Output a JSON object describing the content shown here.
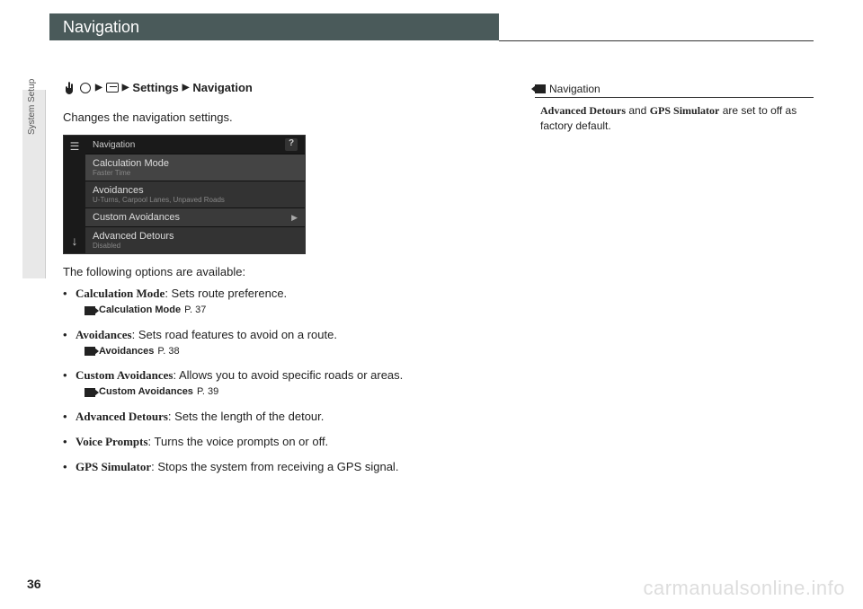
{
  "header": {
    "title": "Navigation"
  },
  "sidebar": {
    "section_label": "System Setup"
  },
  "breadcrumb": {
    "step3": "Settings",
    "step4": "Navigation"
  },
  "intro": "Changes the navigation settings.",
  "screenshot": {
    "title": "Navigation",
    "rows": [
      {
        "title": "Calculation Mode",
        "sub": "Faster Time"
      },
      {
        "title": "Avoidances",
        "sub": "U-Turns, Carpool Lanes, Unpaved Roads"
      },
      {
        "title": "Custom Avoidances",
        "sub": ""
      },
      {
        "title": "Advanced Detours",
        "sub": "Disabled"
      }
    ]
  },
  "options_intro": "The following options are available:",
  "options": [
    {
      "name": "Calculation Mode",
      "desc": ": Sets route preference.",
      "ref_label": "Calculation Mode",
      "ref_page": "P. 37"
    },
    {
      "name": "Avoidances",
      "desc": ": Sets road features to avoid on a route.",
      "ref_label": "Avoidances",
      "ref_page": "P. 38"
    },
    {
      "name": "Custom Avoidances",
      "desc": ": Allows you to avoid specific roads or areas.",
      "ref_label": "Custom Avoidances",
      "ref_page": "P. 39"
    },
    {
      "name": "Advanced Detours",
      "desc": ": Sets the length of the detour."
    },
    {
      "name": "Voice Prompts",
      "desc": ": Turns the voice prompts on or off."
    },
    {
      "name": "GPS Simulator",
      "desc": ": Stops the system from receiving a GPS signal."
    }
  ],
  "sidenote": {
    "title": "Navigation",
    "body_prefix": "Advanced Detours",
    "body_mid": " and ",
    "body_bold2": "GPS Simulator",
    "body_suffix": " are set to off as factory default."
  },
  "page_number": "36",
  "watermark": "carmanualsonline.info"
}
